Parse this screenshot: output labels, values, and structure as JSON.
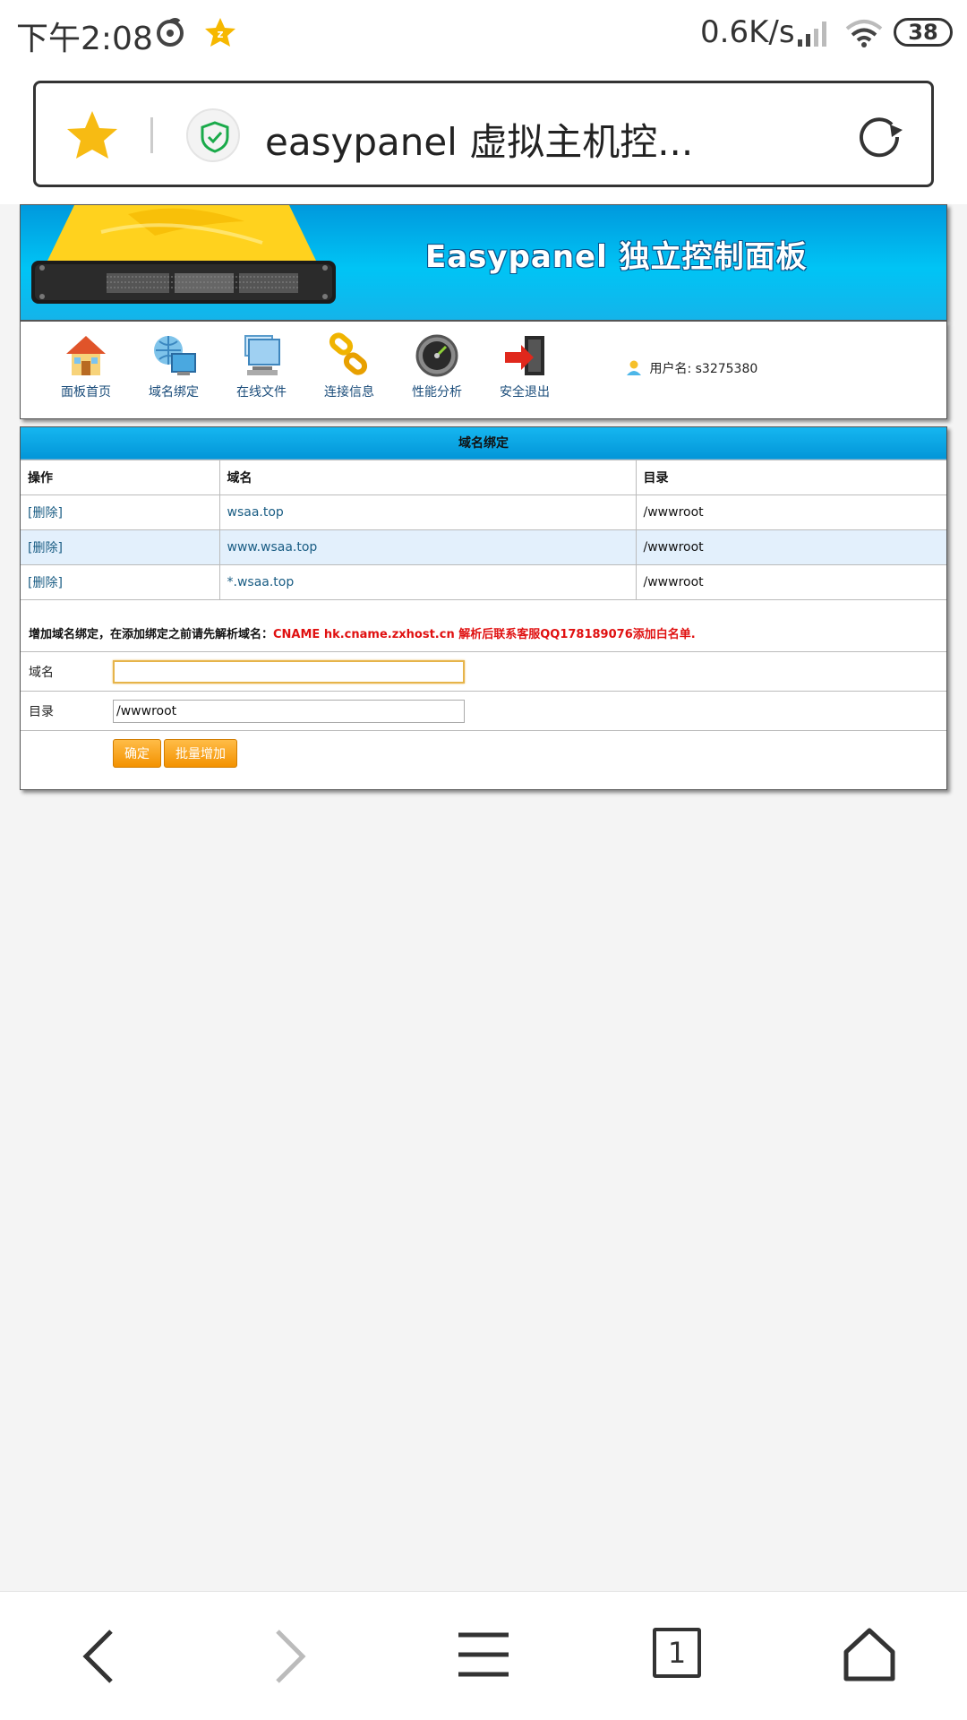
{
  "status_bar": {
    "time": "下午2:08",
    "speed": "0.6K/s",
    "battery": "38"
  },
  "address_bar": {
    "title": "easypanel 虚拟主机控..."
  },
  "banner": {
    "title": "Easypanel 独立控制面板"
  },
  "nav": {
    "items": [
      {
        "label": "面板首页",
        "icon": "home-icon"
      },
      {
        "label": "域名绑定",
        "icon": "domain-globe-icon"
      },
      {
        "label": "在线文件",
        "icon": "file-manager-icon"
      },
      {
        "label": "连接信息",
        "icon": "link-chain-icon"
      },
      {
        "label": "性能分析",
        "icon": "performance-gauge-icon"
      },
      {
        "label": "安全退出",
        "icon": "logout-door-icon"
      }
    ],
    "user_label": "用户名: s3275380"
  },
  "domain_table": {
    "title": "域名绑定",
    "headers": [
      "操作",
      "域名",
      "目录"
    ],
    "rows": [
      {
        "action": "[删除]",
        "domain": "wsaa.top",
        "dir": "/wwwroot"
      },
      {
        "action": "[删除]",
        "domain": "www.wsaa.top",
        "dir": "/wwwroot"
      },
      {
        "action": "[删除]",
        "domain": "*.wsaa.top",
        "dir": "/wwwroot"
      }
    ]
  },
  "add_form": {
    "notice_prefix": "增加域名绑定，在添加绑定之前请先解析域名：",
    "notice_highlight": "CNAME hk.cname.zxhost.cn 解析后联系客服QQ178189076添加白名单.",
    "domain_label": "域名",
    "domain_value": "",
    "dir_label": "目录",
    "dir_value": "/wwwroot",
    "submit_label": "确定",
    "batch_label": "批量增加"
  },
  "bottom_nav": {
    "tab_count": "1"
  },
  "colors": {
    "banner_blue": "#00b2ee",
    "button_orange": "#f7a21b",
    "notice_red": "#e01010",
    "row_highlight": "#e3f0fc"
  }
}
